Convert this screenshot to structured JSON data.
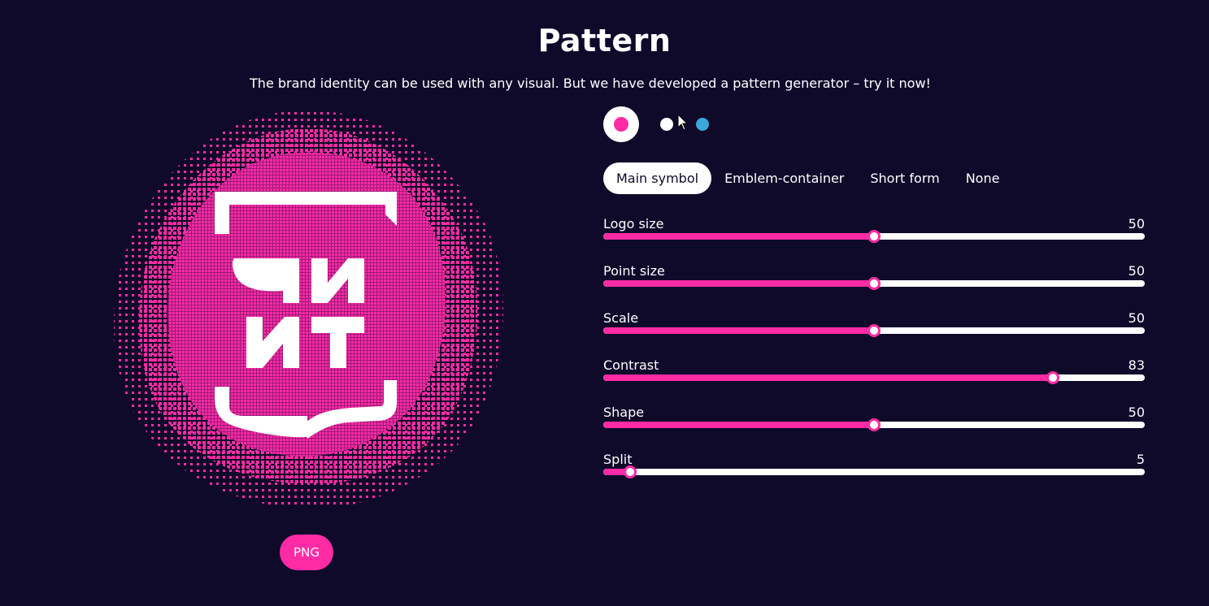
{
  "header": {
    "title": "Pattern",
    "subtitle": "The brand identity can be used with any visual. But we have developed a pattern generator – try it now!"
  },
  "colors": {
    "background": "#0f0a2a",
    "accent": "#ff2ba4",
    "white": "#ffffff",
    "blue": "#3aa8d8"
  },
  "swatches": [
    {
      "name": "pink",
      "color": "#ff2ba4",
      "selected": true
    },
    {
      "name": "white",
      "color": "#ffffff",
      "selected": false
    },
    {
      "name": "blue",
      "color": "#3aa8d8",
      "selected": false
    }
  ],
  "tabs": [
    {
      "label": "Main symbol",
      "active": true
    },
    {
      "label": "Emblem-container",
      "active": false
    },
    {
      "label": "Short form",
      "active": false
    },
    {
      "label": "None",
      "active": false
    }
  ],
  "sliders": [
    {
      "label": "Logo size",
      "value": "50",
      "fraction": 0.5
    },
    {
      "label": "Point size",
      "value": "50",
      "fraction": 0.5
    },
    {
      "label": "Scale",
      "value": "50",
      "fraction": 0.5
    },
    {
      "label": "Contrast",
      "value": "83",
      "fraction": 0.83
    },
    {
      "label": "Shape",
      "value": "50",
      "fraction": 0.5
    },
    {
      "label": "Split",
      "value": "5",
      "fraction": 0.05
    }
  ],
  "export": {
    "png_label": "PNG"
  },
  "icons": {
    "cursor": "mouse-pointer-icon"
  }
}
